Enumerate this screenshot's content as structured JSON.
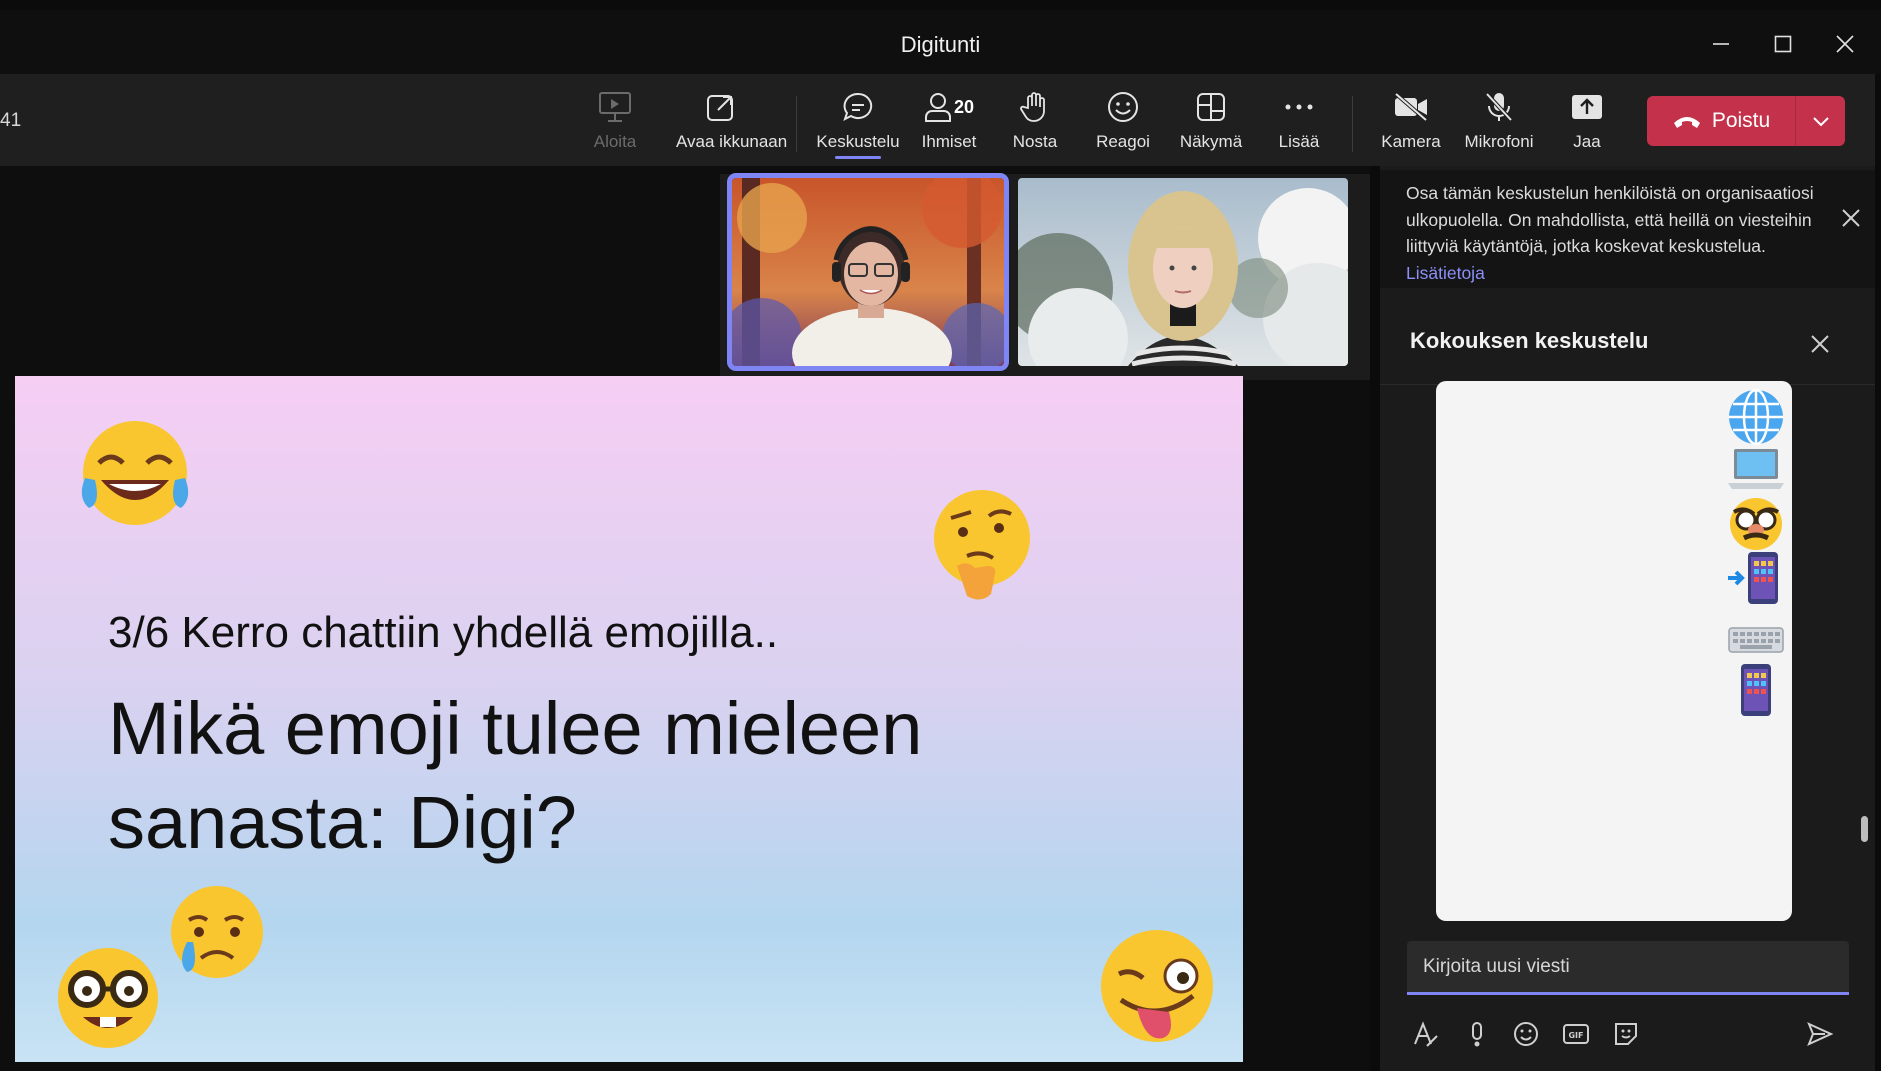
{
  "window": {
    "title": "Digitunti"
  },
  "toolbar": {
    "timer": "41",
    "start": "Aloita",
    "open_window": "Avaa ikkunaan",
    "chat": "Keskustelu",
    "people": "Ihmiset",
    "people_count": "20",
    "raise": "Nosta",
    "react": "Reagoi",
    "view": "Näkymä",
    "more": "Lisää",
    "camera": "Kamera",
    "mic": "Mikrofoni",
    "share": "Jaa",
    "leave": "Poistu"
  },
  "slide": {
    "line1": "3/6 Kerro chattiin yhdellä emojilla..",
    "line2": "Mikä emoji tulee mieleen",
    "line3": "sanasta: Digi?"
  },
  "chat_panel": {
    "notice_text": "Osa tämän keskustelun henkilöistä on organisaatiosi ulkopuolella. On mahdollista, että heillä on viesteihin liittyviä käytäntöjä, jotka koskevat keskustelua.",
    "notice_link": "Lisätietoja",
    "title": "Kokouksen keskustelu",
    "compose_placeholder": "Kirjoita uusi viesti"
  },
  "colors": {
    "accent": "#7f85f5",
    "leave": "#c4314b"
  }
}
